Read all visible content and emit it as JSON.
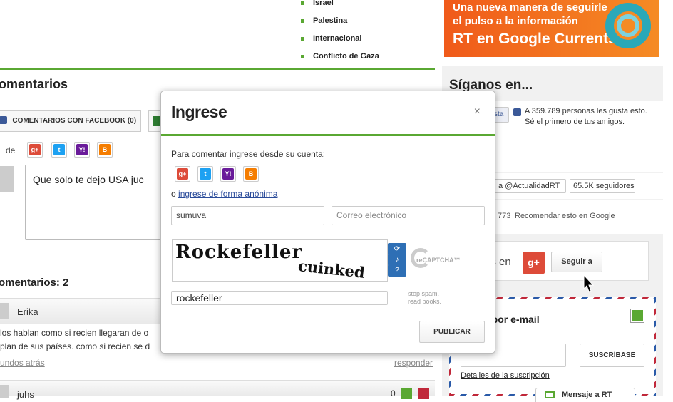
{
  "nav_items": [
    "Israel",
    "Palestina",
    "Internacional",
    "Conflicto de Gaza"
  ],
  "banner": {
    "line1": "Una nueva manera de seguirle",
    "line2": "el pulso a la información",
    "line3": "RT en Google Currents"
  },
  "comments": {
    "section_title": "omentarios",
    "tab_facebook": "COMENTARIOS CON FACEBOOK (0)",
    "share_prefix": "de",
    "draft_text": "Que solo te dejo USA juc",
    "count_label": "omentarios: 2",
    "entries": [
      {
        "author": "Erika",
        "line1": "los hablan como si recien llegaran de o",
        "line2": "plan de sus países. como si recien se d",
        "time": "undos atrás",
        "reply": "responder"
      },
      {
        "author": "juhs",
        "score": "0"
      }
    ]
  },
  "sidebar": {
    "follow_title": "Síganos en...",
    "fb_like_btn": "sta",
    "fb_text_1": "A 359.789 personas les gusta esto.",
    "fb_text_2": "Sé el primero de tus amigos.",
    "twitter_btn": "a @ActualidadRT",
    "twitter_count": "65.5K seguidores",
    "gplus_count": "773",
    "gplus_recommend": "Recomendar esto en Google",
    "gplus_follow_prefix": "os en",
    "gplus_follow_btn": "Seguir a",
    "email_title": "s por e-mail",
    "subscribe_btn": "SUSCRÍBASE",
    "subscription_details": "Detalles de la suscripción",
    "message_tab": "Mensaje a RT"
  },
  "modal": {
    "title": "Ingrese",
    "close": "×",
    "prompt": "Para comentar ingrese desde su cuenta:",
    "anon_prefix": "o",
    "anon_link": "ingrese de forma anónima",
    "name_value": "sumuva",
    "email_placeholder": "Correo electrónico",
    "captcha_word1": "Rockefeller",
    "captcha_word2": "cuinked",
    "captcha_logo": "reCAPTCHA™",
    "captcha_answer": "rockefeller",
    "captcha_tagline_1": "stop spam.",
    "captcha_tagline_2": "read books.",
    "publish_btn": "PUBLICAR"
  },
  "colors": {
    "accent_green": "#5aa832",
    "banner_orange": "#f05a1a",
    "link_blue": "#2a4b9a",
    "gplus_red": "#dd4b39",
    "twitter_blue": "#1da1f2",
    "yahoo_purple": "#6a1b9a",
    "blogger_orange": "#f57d00"
  }
}
